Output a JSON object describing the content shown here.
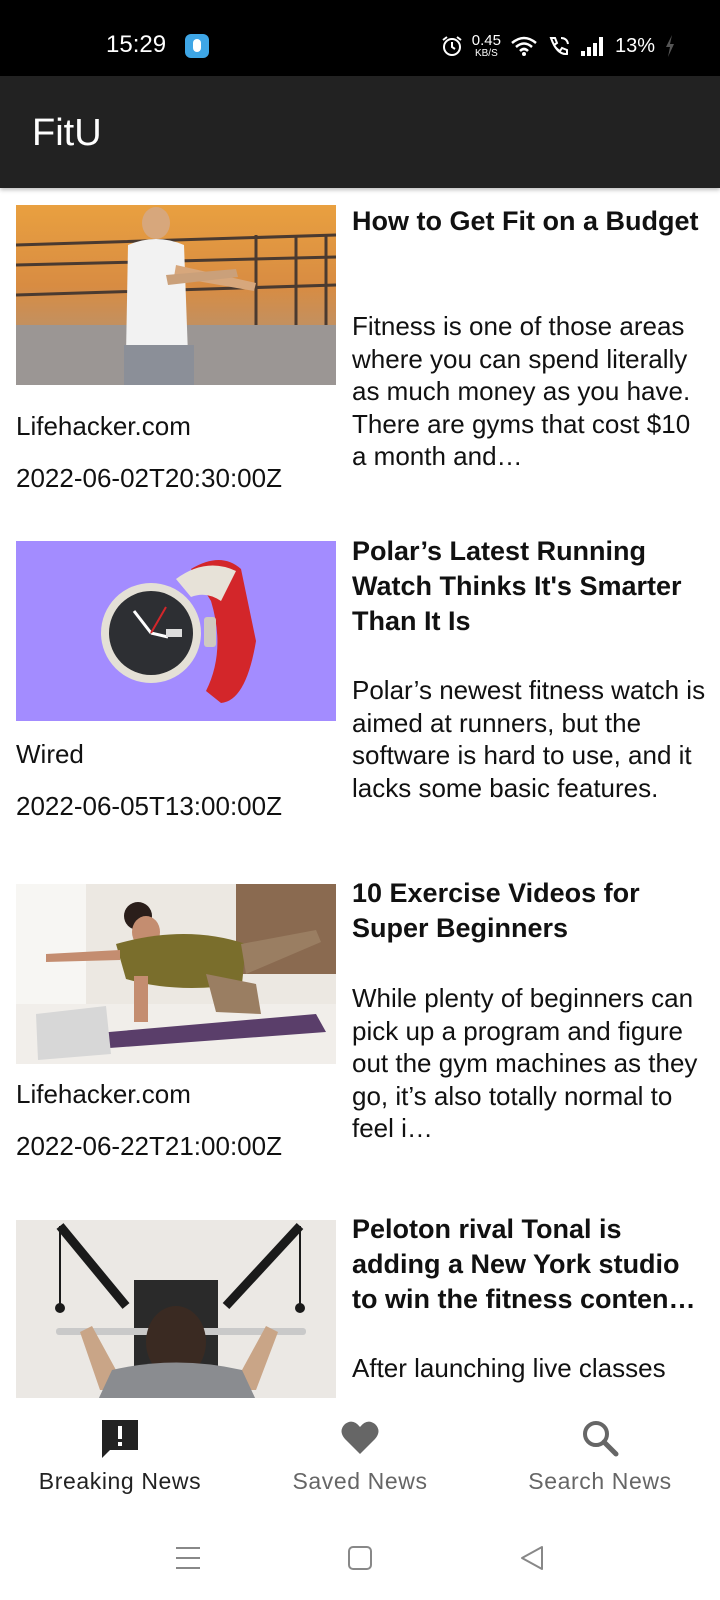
{
  "status_bar": {
    "time": "15:29",
    "net_speed_value": "0.45",
    "net_speed_unit": "KB/S",
    "battery": "13%",
    "icons": [
      "app-notification-icon",
      "alarm-icon",
      "wifi-icon",
      "wifi-calling-icon",
      "signal-icon",
      "charging-icon"
    ]
  },
  "app_bar": {
    "title": "FitU"
  },
  "articles": [
    {
      "title": "How to Get Fit on a Budget",
      "description": "Fitness is one of those areas where you can spend literally as much money as you have. There are gyms that cost $10 a month and…",
      "source": "Lifehacker.com",
      "published_at": "2022-06-02T20:30:00Z",
      "image": "woman stretching on a bridge at sunset"
    },
    {
      "title": "Polar’s Latest Running Watch Thinks It's Smarter Than It Is",
      "description": "Polar’s newest fitness watch is aimed at runners, but the software is hard to use, and it lacks some basic features.",
      "source": "Wired",
      "published_at": "2022-06-05T13:00:00Z",
      "image": "sports watch with red strap on purple background"
    },
    {
      "title": "10 Exercise Videos for Super Beginners",
      "description": "While plenty of beginners can pick up a program and figure out the gym machines as they go, it’s also totally normal to feel i…",
      "source": "Lifehacker.com",
      "published_at": "2022-06-22T21:00:00Z",
      "image": "woman exercising on a yoga mat with laptop"
    },
    {
      "title": "Peloton rival Tonal is adding a New York studio to win the fitness conten…",
      "description": "After launching live classes",
      "source": "",
      "published_at": "",
      "image": "person pulling bar on wall-mounted trainer"
    }
  ],
  "bottom_nav": {
    "items": [
      {
        "label": "Breaking News",
        "icon": "breaking-news-icon",
        "active": true
      },
      {
        "label": "Saved News",
        "icon": "heart-icon",
        "active": false
      },
      {
        "label": "Search News",
        "icon": "search-icon",
        "active": false
      }
    ],
    "active_color": "#222222",
    "inactive_color": "#666666"
  },
  "system_nav": {
    "icons": [
      "menu-icon",
      "home-icon",
      "back-icon"
    ]
  }
}
